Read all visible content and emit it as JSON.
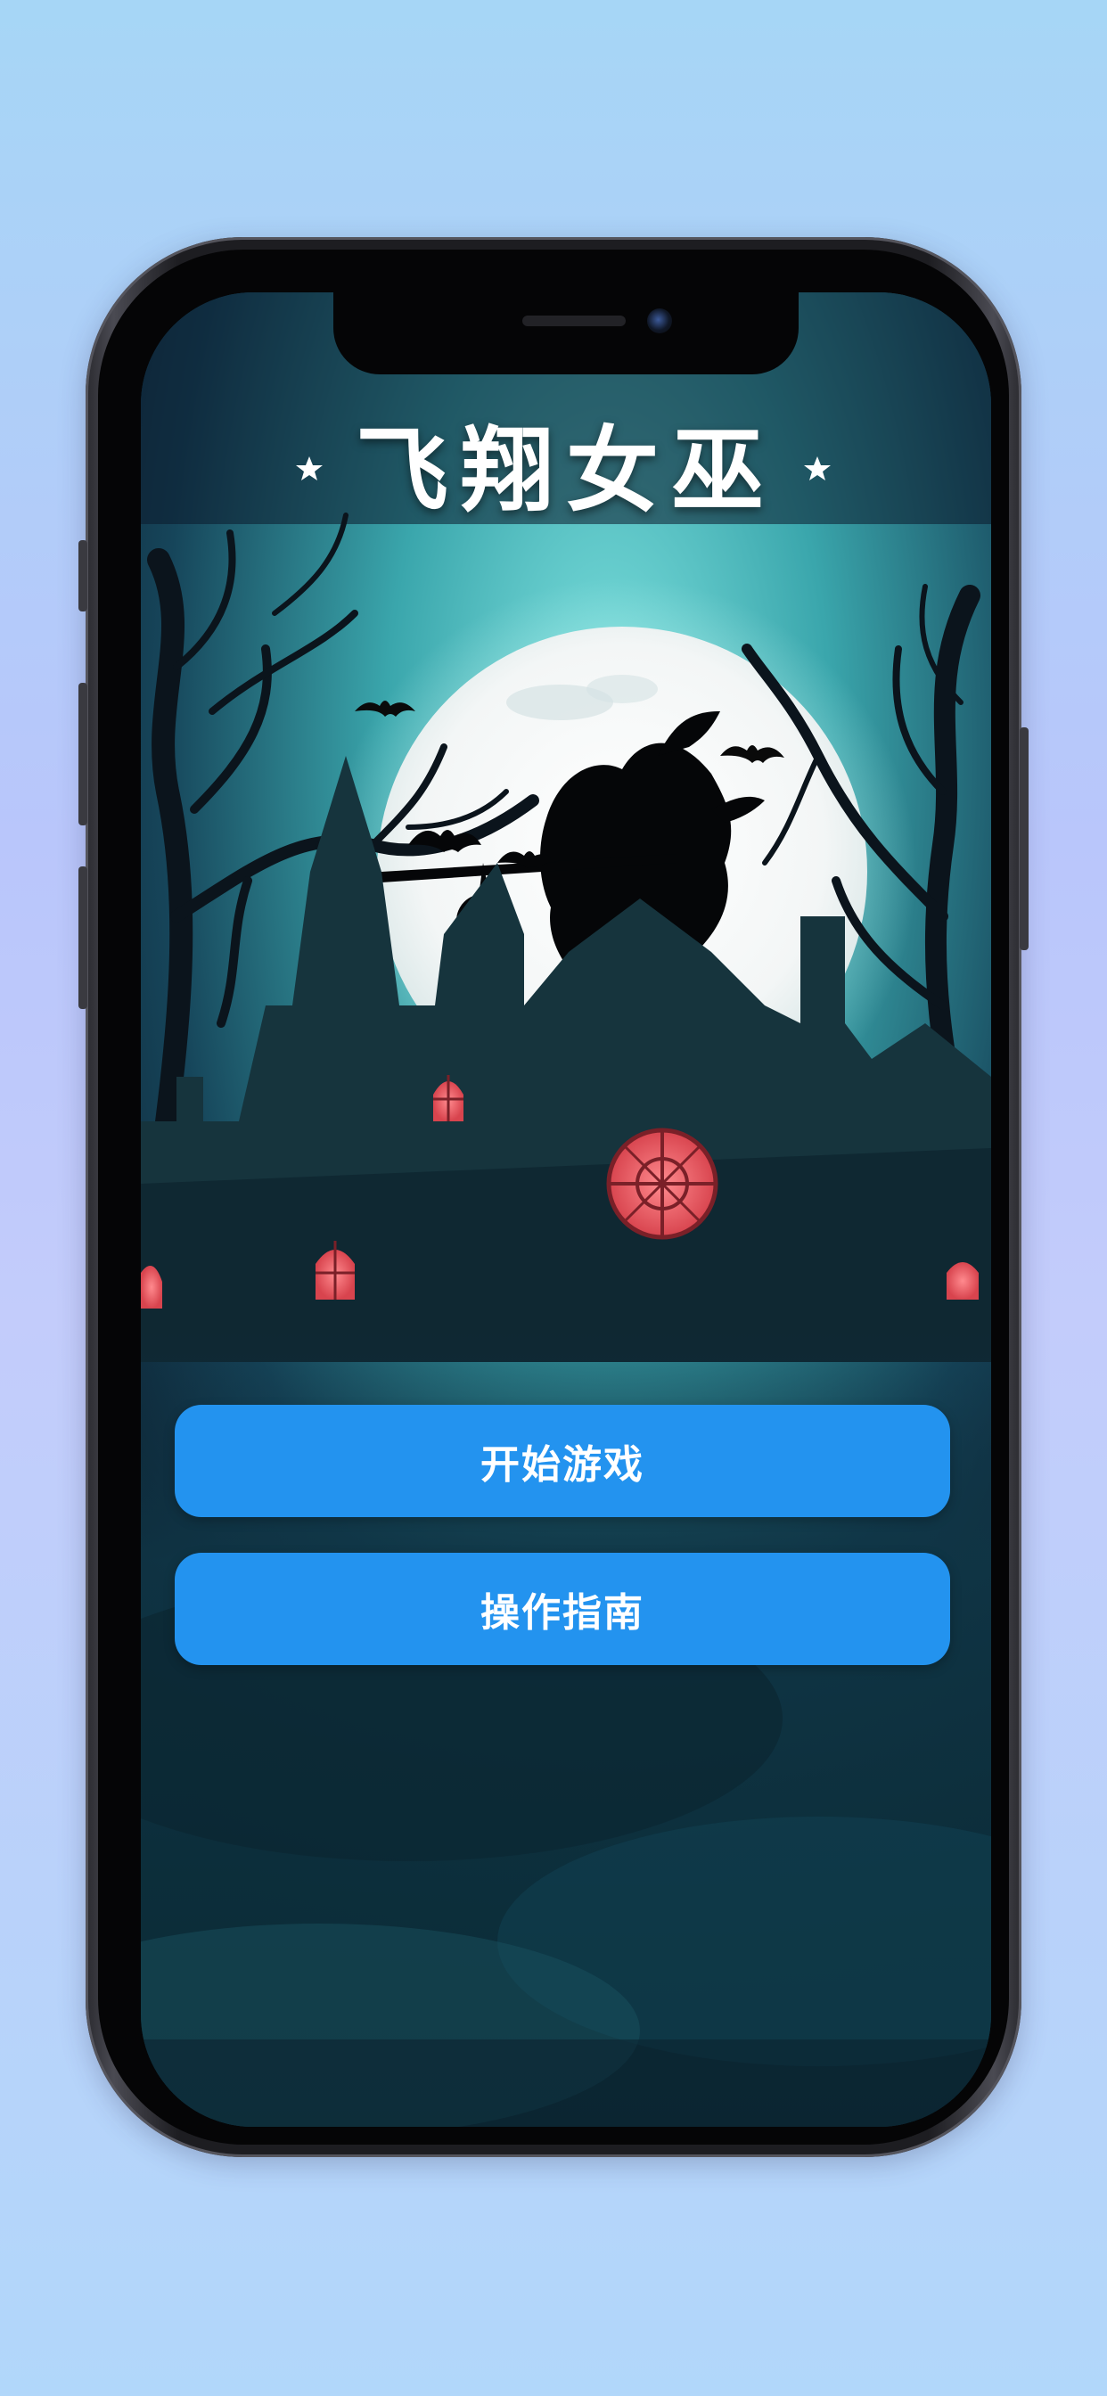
{
  "game": {
    "title": "飞翔女巫"
  },
  "menu": {
    "start_label": "开始游戏",
    "guide_label": "操作指南"
  },
  "colors": {
    "button": "#2393ef",
    "moon": "#f4f6f6",
    "window_glow": "#f0606a",
    "sky_top": "#0d1e33",
    "sky_mid": "#3fb3b5"
  },
  "icons": [
    "star-icon",
    "bat-icon",
    "witch-silhouette",
    "moon",
    "haunted-house"
  ]
}
